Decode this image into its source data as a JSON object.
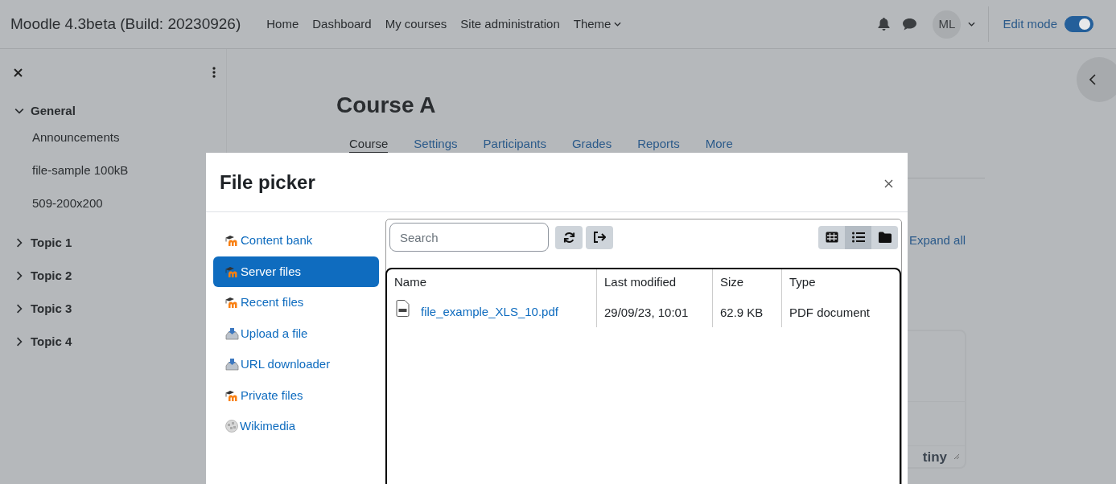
{
  "header": {
    "site_name": "Moodle 4.3beta (Build: 20230926)",
    "nav": [
      {
        "label": "Home",
        "dropdown": false
      },
      {
        "label": "Dashboard",
        "dropdown": false
      },
      {
        "label": "My courses",
        "dropdown": false
      },
      {
        "label": "Site administration",
        "dropdown": false
      },
      {
        "label": "Theme",
        "dropdown": true
      }
    ],
    "avatar": "ML",
    "edit_mode": {
      "label": "Edit mode",
      "on": true
    }
  },
  "drawer": {
    "sections": [
      {
        "title": "General",
        "expanded": true,
        "children": [
          "Announcements",
          "file-sample 100kB",
          "509-200x200"
        ]
      },
      {
        "title": "Topic 1",
        "expanded": false
      },
      {
        "title": "Topic 2",
        "expanded": false
      },
      {
        "title": "Topic 3",
        "expanded": false
      },
      {
        "title": "Topic 4",
        "expanded": false
      }
    ]
  },
  "course": {
    "title": "Course A",
    "tabs": [
      {
        "label": "Course",
        "selected": true
      },
      {
        "label": "Settings",
        "selected": false
      },
      {
        "label": "Participants",
        "selected": false
      },
      {
        "label": "Grades",
        "selected": false
      },
      {
        "label": "Reports",
        "selected": false
      },
      {
        "label": "More",
        "selected": false
      }
    ],
    "expand_all": "Expand all",
    "editor_logo": "tiny"
  },
  "file_picker": {
    "title": "File picker",
    "repositories": [
      {
        "label": "Content bank",
        "kind": "moodle",
        "selected": false
      },
      {
        "label": "Server files",
        "kind": "moodle",
        "selected": true
      },
      {
        "label": "Recent files",
        "kind": "moodle",
        "selected": false
      },
      {
        "label": "Upload a file",
        "kind": "upload",
        "selected": false
      },
      {
        "label": "URL downloader",
        "kind": "upload",
        "selected": false
      },
      {
        "label": "Private files",
        "kind": "moodle",
        "selected": false
      },
      {
        "label": "Wikimedia",
        "kind": "wiki",
        "selected": false
      }
    ],
    "search": {
      "placeholder": "Search"
    },
    "views": [
      {
        "kind": "icons",
        "selected": false
      },
      {
        "kind": "list",
        "selected": true
      },
      {
        "kind": "tree",
        "selected": false
      }
    ],
    "columns": [
      "Name",
      "Last modified",
      "Size",
      "Type"
    ],
    "rows": [
      {
        "name": "file_example_XLS_10.pdf",
        "modified": "29/09/23, 10:01",
        "size": "62.9 KB",
        "type": "PDF document"
      }
    ]
  }
}
